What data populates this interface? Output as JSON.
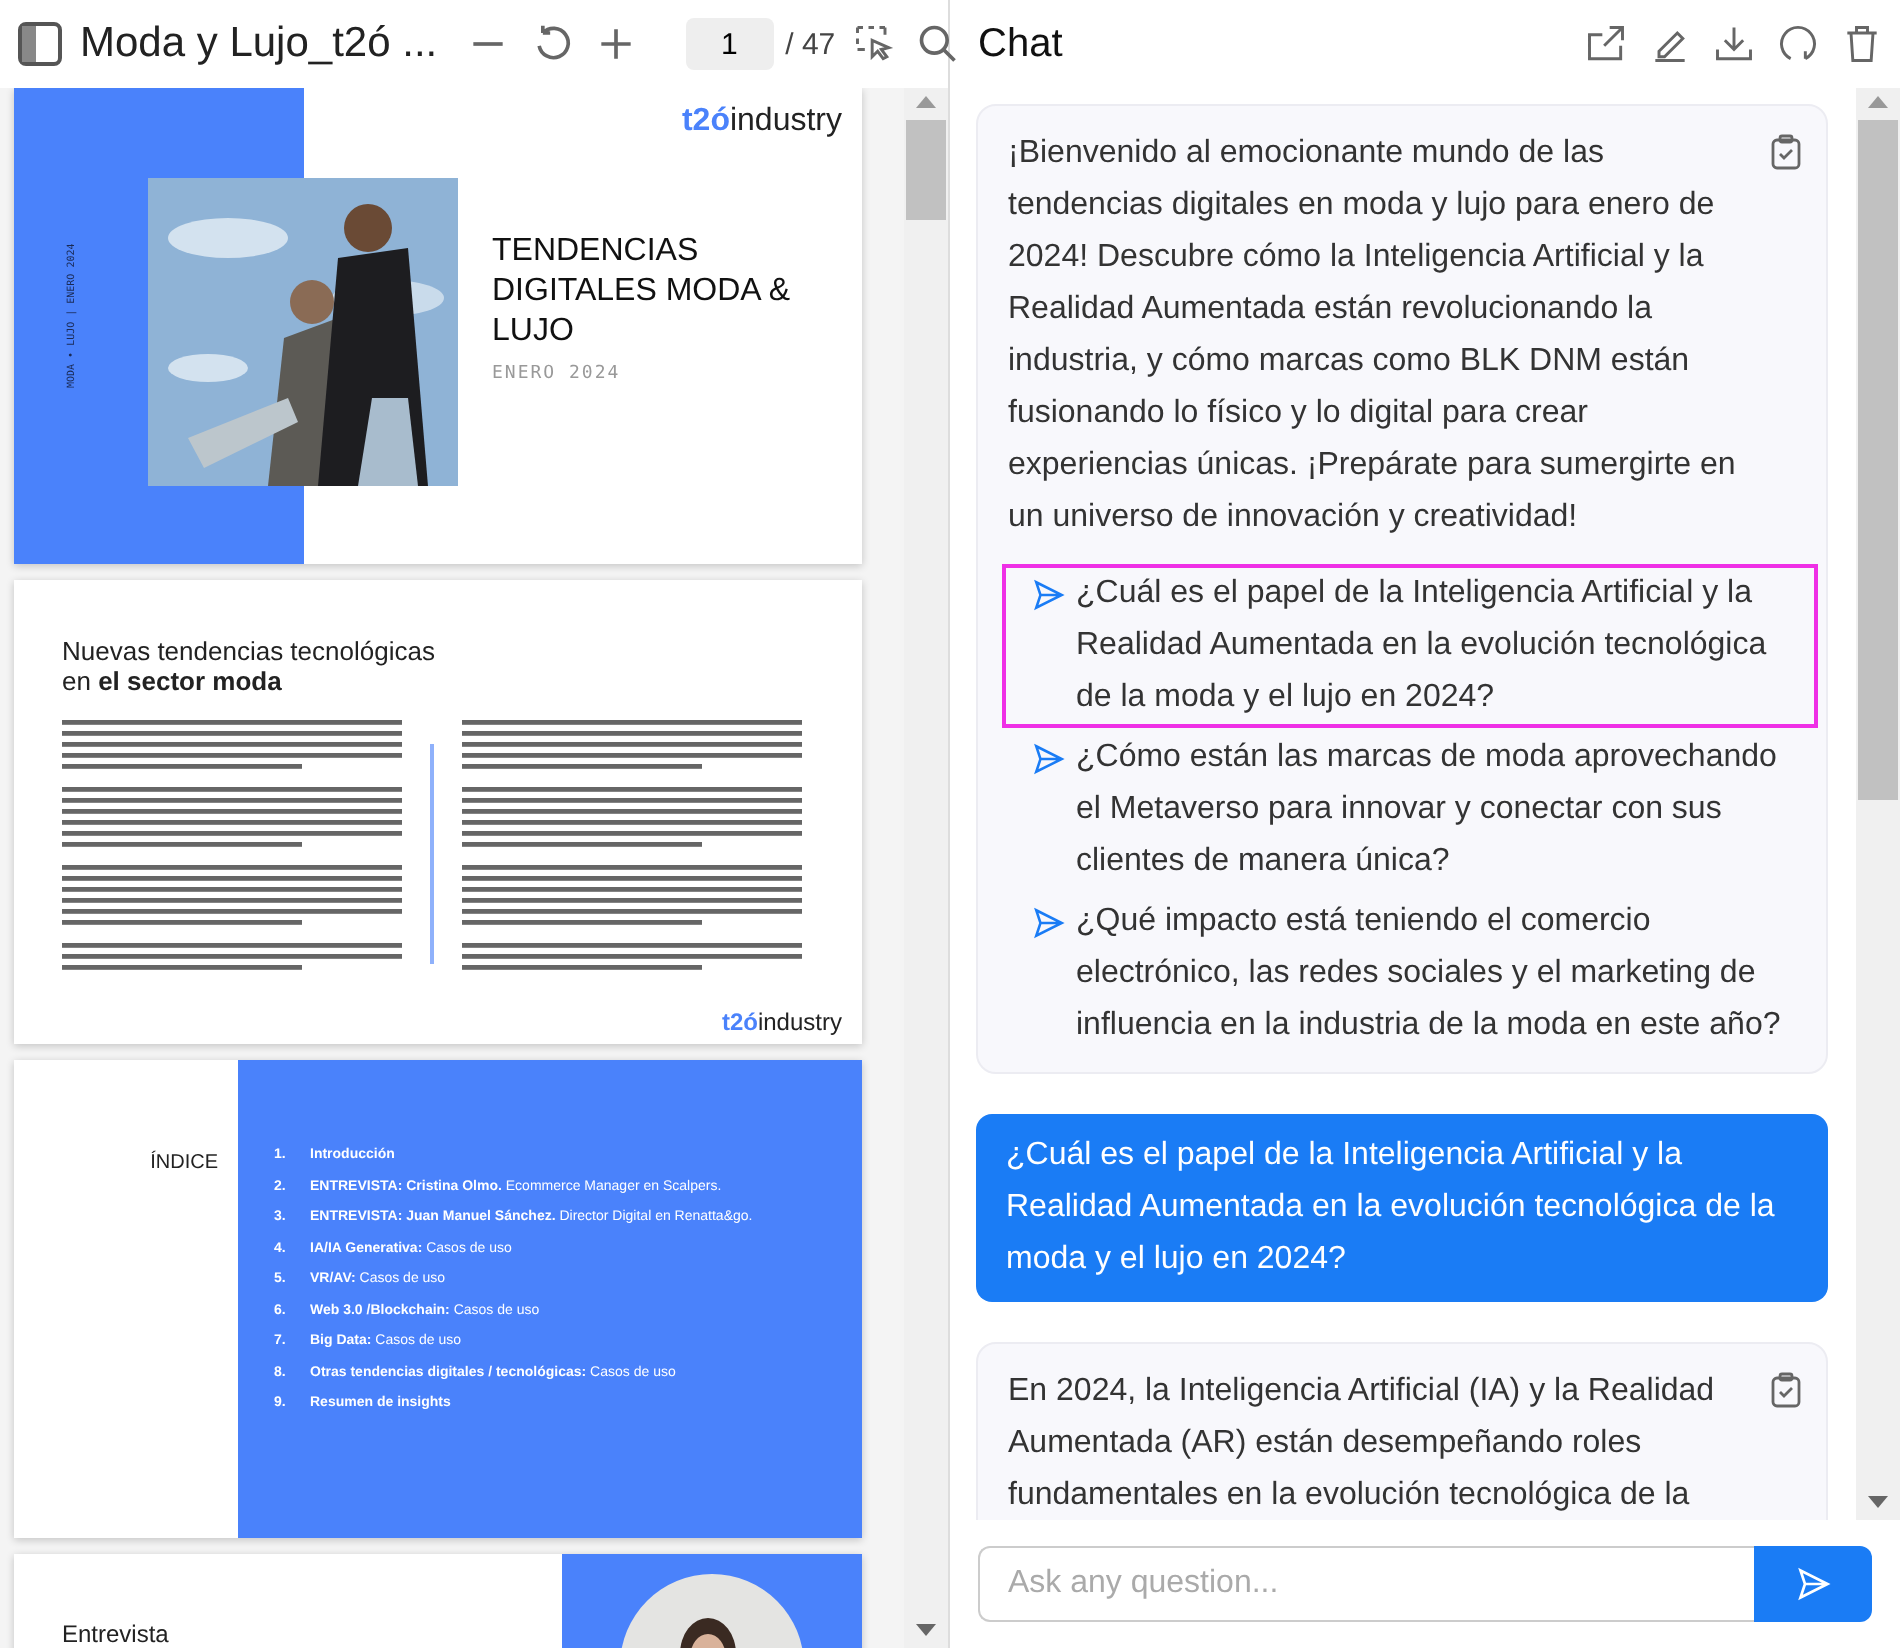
{
  "viewer": {
    "title": "Moda y Lujo_t2ó ...",
    "page_input": "1",
    "page_total": "/ 47",
    "page1": {
      "logo": {
        "mark": "t2ó",
        "name": "industry"
      },
      "side_text": "MODA • LUJO | ENERO 2024",
      "title": "TENDENCIAS DIGITALES MODA & LUJO",
      "date": "ENERO 2024"
    },
    "page2": {
      "title_lines": [
        "Nuevas tendencias tecnológicas",
        "en **el sector moda**"
      ],
      "logo": {
        "mark": "t2ó",
        "name": "industry"
      }
    },
    "page3": {
      "heading": "ÍNDICE",
      "items": [
        {
          "number": "1.",
          "text": "**Introducción**"
        },
        {
          "number": "2.",
          "text": "**ENTREVISTA: Cristina Olmo.** Ecommerce Manager en Scalpers."
        },
        {
          "number": "3.",
          "text": "**ENTREVISTA: Juan Manuel Sánchez.** Director Digital en Renatta&go."
        },
        {
          "number": "4.",
          "text": "**IA/IA Generativa:** Casos de uso"
        },
        {
          "number": "5.",
          "text": "**VR/AV:** Casos de uso"
        },
        {
          "number": "6.",
          "text": "**Web 3.0 /Blockchain:** Casos de uso"
        },
        {
          "number": "7.",
          "text": "**Big Data:** Casos de uso"
        },
        {
          "number": "8.",
          "text": "**Otras tendencias digitales / tecnológicas:** Casos de uso"
        },
        {
          "number": "9.",
          "text": "**Resumen de insights**"
        }
      ]
    },
    "page4": {
      "heading": "Entrevista"
    }
  },
  "chat": {
    "title": "Chat",
    "messages": [
      {
        "kind": "bot",
        "text": "¡Bienvenido al emocionante mundo de las tendencias digitales en moda y lujo para enero de 2024! Descubre cómo la Inteligencia Artificial y la Realidad Aumentada están revolucionando la industria, y cómo marcas como BLK DNM están fusionando lo físico y lo digital para crear experiencias únicas. ¡Prepárate para sumergirte en un universo de innovación y creatividad!",
        "questions": [
          {
            "text": "¿Cuál es el papel de la Inteligencia Artificial y la Realidad Aumentada en la evolución tecnológica de la moda y el lujo en 2024?",
            "highlighted": true
          },
          {
            "text": "¿Cómo están las marcas de moda aprovechando el Metaverso para innovar y conectar con sus clientes de manera única?",
            "highlighted": false
          },
          {
            "text": "¿Qué impacto está teniendo el comercio electrónico, las redes sociales y el marketing de influencia en la industria de la moda en este año?",
            "highlighted": false
          }
        ]
      },
      {
        "kind": "user",
        "text": "¿Cuál es el papel de la Inteligencia Artificial y la Realidad Aumentada en la evolución tecnológica de la moda y el lujo en 2024?"
      },
      {
        "kind": "bot",
        "text": "En 2024, la Inteligencia Artificial (IA) y la Realidad Aumentada (AR) están desempeñando roles fundamentales en la evolución tecnológica de la"
      }
    ],
    "input_placeholder": "Ask any question..."
  }
}
